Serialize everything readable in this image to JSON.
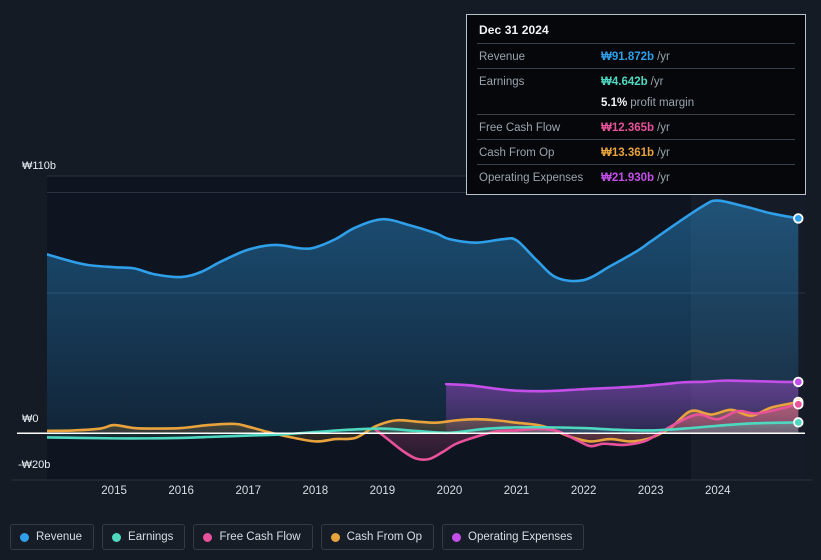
{
  "chart_data": {
    "type": "area",
    "title": "",
    "xlabel": "",
    "ylabel": "",
    "currency": "₩",
    "xlim": [
      2014.0,
      2025.3
    ],
    "ylim": [
      -20,
      110
    ],
    "ytick_labels": [
      "₩110b",
      "₩0",
      "-₩20b"
    ],
    "ytick_values": [
      110,
      0,
      -20
    ],
    "gridlines": [
      110,
      103,
      60,
      0
    ],
    "grid": true,
    "legend_position": "bottom-left",
    "x_tick_labels": [
      "2015",
      "2016",
      "2017",
      "2018",
      "2019",
      "2020",
      "2021",
      "2022",
      "2023",
      "2024"
    ],
    "x_tick_values": [
      2015,
      2016,
      2017,
      2018,
      2019,
      2020,
      2021,
      2022,
      2023,
      2024
    ],
    "forecast_start": 2023.6,
    "series": [
      {
        "name": "Revenue",
        "color": "#2e9fe8",
        "end_value": 91.872,
        "x": [
          2014.0,
          2014.3,
          2014.6,
          2015.0,
          2015.3,
          2015.6,
          2016.0,
          2016.3,
          2016.6,
          2017.0,
          2017.4,
          2017.8,
          2018.0,
          2018.3,
          2018.6,
          2019.0,
          2019.4,
          2019.8,
          2020.0,
          2020.4,
          2020.8,
          2021.0,
          2021.3,
          2021.6,
          2022.0,
          2022.4,
          2022.8,
          2023.0,
          2023.4,
          2023.8,
          2024.0,
          2024.4,
          2024.8,
          2025.2
        ],
        "y": [
          76.5,
          74.0,
          72.0,
          71.0,
          70.5,
          68.0,
          66.8,
          69.0,
          73.5,
          78.5,
          80.5,
          79.0,
          79.5,
          83.0,
          88.0,
          91.5,
          89.0,
          85.5,
          83.0,
          81.5,
          83.0,
          82.5,
          74.0,
          66.5,
          65.5,
          71.5,
          78.0,
          82.0,
          90.0,
          97.5,
          99.5,
          97.0,
          94.0,
          91.872
        ]
      },
      {
        "name": "Earnings",
        "color": "#4fd8c0",
        "end_value": 4.642,
        "x": [
          2014.0,
          2014.5,
          2015.0,
          2015.5,
          2016.0,
          2016.5,
          2017.0,
          2017.5,
          2018.0,
          2018.5,
          2019.0,
          2019.5,
          2020.0,
          2020.5,
          2021.0,
          2021.5,
          2022.0,
          2022.5,
          2023.0,
          2023.5,
          2024.0,
          2024.5,
          2025.2
        ],
        "y": [
          -1.8,
          -2.0,
          -2.2,
          -2.2,
          -2.0,
          -1.5,
          -1.0,
          -0.5,
          0.5,
          1.5,
          2.0,
          1.0,
          0.2,
          1.8,
          2.5,
          2.5,
          2.2,
          1.5,
          1.2,
          2.0,
          3.2,
          4.2,
          4.642
        ]
      },
      {
        "name": "Free Cash Flow",
        "color": "#e8529a",
        "end_value": 12.365,
        "x": [
          2018.9,
          2019.1,
          2019.3,
          2019.5,
          2019.7,
          2019.9,
          2020.1,
          2020.4,
          2020.7,
          2021.0,
          2021.3,
          2021.6,
          2021.9,
          2022.1,
          2022.3,
          2022.6,
          2022.9,
          2023.1,
          2023.4,
          2023.7,
          2024.0,
          2024.3,
          2024.6,
          2025.2
        ],
        "y": [
          1.5,
          -3.0,
          -7.5,
          -10.8,
          -11.0,
          -8.0,
          -4.5,
          -1.5,
          0.8,
          1.2,
          1.8,
          1.0,
          -3.0,
          -5.5,
          -4.5,
          -5.0,
          -3.5,
          -0.5,
          4.5,
          8.0,
          6.0,
          9.5,
          8.5,
          12.365
        ]
      },
      {
        "name": "Cash From Op",
        "color": "#e8a33d",
        "end_value": 13.361,
        "x": [
          2014.0,
          2014.4,
          2014.8,
          2015.0,
          2015.3,
          2015.6,
          2016.0,
          2016.4,
          2016.8,
          2017.0,
          2017.3,
          2017.6,
          2018.0,
          2018.3,
          2018.6,
          2018.9,
          2019.2,
          2019.5,
          2019.8,
          2020.1,
          2020.4,
          2020.7,
          2021.0,
          2021.4,
          2021.8,
          2022.1,
          2022.4,
          2022.7,
          2023.0,
          2023.3,
          2023.6,
          2023.9,
          2024.2,
          2024.5,
          2024.8,
          2025.2
        ],
        "y": [
          1.0,
          1.2,
          2.0,
          3.5,
          2.2,
          2.0,
          2.2,
          3.5,
          4.0,
          2.8,
          0.5,
          -1.5,
          -3.5,
          -2.5,
          -2.0,
          3.0,
          5.5,
          5.0,
          4.5,
          5.5,
          6.0,
          5.5,
          4.5,
          3.0,
          -1.5,
          -3.5,
          -2.5,
          -3.5,
          -2.0,
          2.5,
          9.5,
          8.0,
          10.0,
          7.5,
          11.0,
          13.361
        ]
      },
      {
        "name": "Operating Expenses",
        "color": "#c44fe8",
        "end_value": 21.93,
        "x": [
          2019.95,
          2020.3,
          2020.7,
          2021.0,
          2021.4,
          2021.8,
          2022.1,
          2022.5,
          2022.9,
          2023.2,
          2023.5,
          2023.8,
          2024.1,
          2024.5,
          2024.9,
          2025.2
        ],
        "y": [
          21.0,
          20.5,
          19.0,
          18.2,
          18.0,
          18.5,
          19.0,
          19.5,
          20.2,
          21.0,
          21.8,
          22.0,
          22.5,
          22.3,
          22.0,
          21.93
        ]
      }
    ]
  },
  "tooltip": {
    "title": "Dec 31 2024",
    "unit_suffix": "/yr",
    "rows": [
      {
        "label": "Revenue",
        "value": "₩91.872b",
        "color": "#2e9fe8",
        "unit": "/yr"
      },
      {
        "label": "Earnings",
        "value": "₩4.642b",
        "color": "#4fd8c0",
        "unit": "/yr"
      },
      {
        "label": "",
        "value": "5.1%",
        "color": "#f2f5f8",
        "unit": "profit margin",
        "sub": true
      },
      {
        "label": "Free Cash Flow",
        "value": "₩12.365b",
        "color": "#e8529a",
        "unit": "/yr"
      },
      {
        "label": "Cash From Op",
        "value": "₩13.361b",
        "color": "#e8a33d",
        "unit": "/yr"
      },
      {
        "label": "Operating Expenses",
        "value": "₩21.930b",
        "color": "#c44fe8",
        "unit": "/yr"
      }
    ]
  },
  "y_axis": {
    "top_label": "₩110b",
    "zero_label": "₩0",
    "bottom_label": "-₩20b"
  },
  "legend": {
    "items": [
      {
        "label": "Revenue",
        "color": "#2e9fe8"
      },
      {
        "label": "Earnings",
        "color": "#4fd8c0"
      },
      {
        "label": "Free Cash Flow",
        "color": "#e8529a"
      },
      {
        "label": "Cash From Op",
        "color": "#e8a33d"
      },
      {
        "label": "Operating Expenses",
        "color": "#c44fe8"
      }
    ]
  },
  "colors": {
    "background": "#141b25",
    "plot_background": "#0e1420",
    "zero_line": "#ffffff",
    "grid": "#2a3440"
  }
}
